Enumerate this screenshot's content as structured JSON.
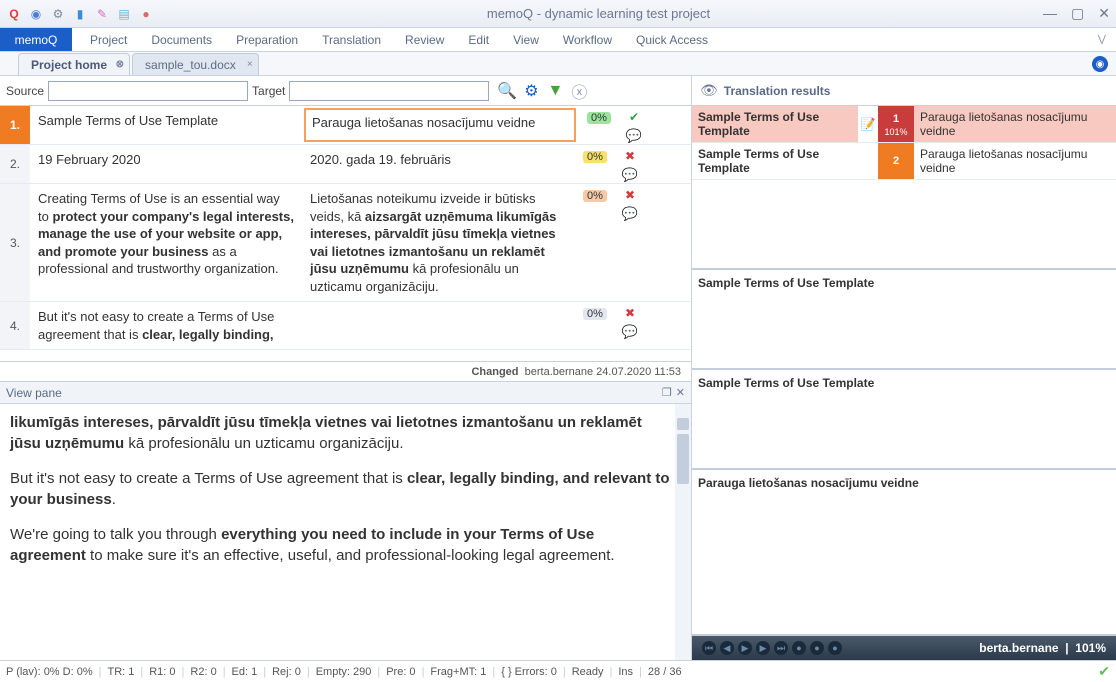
{
  "title": "memoQ - dynamic learning test project",
  "toolbar_icons": [
    "q-icon",
    "globe-icon",
    "gear-icon",
    "book-icon",
    "tools-icon",
    "files-icon",
    "mic-icon"
  ],
  "menu": {
    "brand": "memoQ",
    "items": [
      "Project",
      "Documents",
      "Preparation",
      "Translation",
      "Review",
      "Edit",
      "View",
      "Workflow",
      "Quick Access"
    ]
  },
  "tabs": [
    {
      "label": "Project home",
      "active": true
    },
    {
      "label": "sample_tou.docx",
      "active": false
    }
  ],
  "source_label": "Source",
  "target_label": "Target",
  "segments": [
    {
      "n": "1.",
      "src": "Sample Terms of Use Template",
      "tgt": "Parauga lietošanas nosacījumu veidne",
      "pct": "0%",
      "pct_cls": "pct-green",
      "status": "ok",
      "active": true
    },
    {
      "n": "2.",
      "src": "19 February 2020",
      "tgt": "2020. gada 19. februāris",
      "pct": "0%",
      "pct_cls": "pct-yellow",
      "status": "x"
    },
    {
      "n": "3.",
      "src_html": "Creating Terms of Use is an essential way to <b>protect your company's legal interests, manage the use of your website or app, and promote your business</b> as a professional and trustworthy organization.",
      "tgt_html": "Lietošanas noteikumu izveide ir būtisks veids, kā <b>aizsargāt uzņēmuma likumīgās intereses, pārvaldīt jūsu tīmekļa vietnes vai lietotnes izmantošanu un reklamēt jūsu uzņēmumu</b> kā profesionālu un uzticamu organizāciju.",
      "pct": "0%",
      "pct_cls": "pct-orange",
      "status": "x"
    },
    {
      "n": "4.",
      "src_html": "But it's not easy to create a Terms of Use agreement that is <b>clear, legally binding,</b>",
      "tgt": "",
      "pct": "0%",
      "pct_cls": "pct-grey",
      "status": "x"
    }
  ],
  "changed_label": "Changed",
  "changed_value": "berta.bernane 24.07.2020 11:53",
  "viewpane": {
    "title": "View pane",
    "para1_html": "<b>likumīgās intereses, pārvaldīt jūsu tīmekļa vietnes vai lietotnes izmantošanu un reklamēt jūsu uzņēmumu</b> kā profesionālu un uzticamu organizāciju.",
    "para2_html": "But it's not easy to create a Terms of Use agreement that is <b>clear, legally binding, and relevant to your business</b>.",
    "para3_html": "We're going to talk you through <b>everything you need to include in your Terms of Use agreement</b> to make sure it's an effective, useful, and professional-looking legal agreement."
  },
  "results": {
    "title": "Translation results",
    "rows": [
      {
        "src": "Sample Terms of Use Template",
        "num": "1",
        "pct": "101%",
        "tgt": "Parauga lietošanas nosacījumu veidne"
      },
      {
        "src": "Sample Terms of Use Template",
        "num": "2",
        "pct": "",
        "tgt": "Parauga lietošanas nosacījumu veidne"
      }
    ],
    "box1": "Sample Terms of Use Template",
    "box2": "Sample Terms of Use Template",
    "box3": "Parauga lietošanas nosacījumu veidne"
  },
  "userbar": {
    "user": "berta.bernane",
    "pct": "101%"
  },
  "status": {
    "items": [
      "P (lav): 0%  D: 0%",
      "TR: 1",
      "R1: 0",
      "R2: 0",
      "Ed: 1",
      "Rej: 0",
      "Empty: 290",
      "Pre: 0",
      "Frag+MT: 1",
      "{ } Errors: 0",
      "Ready",
      "Ins",
      "28 / 36"
    ]
  }
}
